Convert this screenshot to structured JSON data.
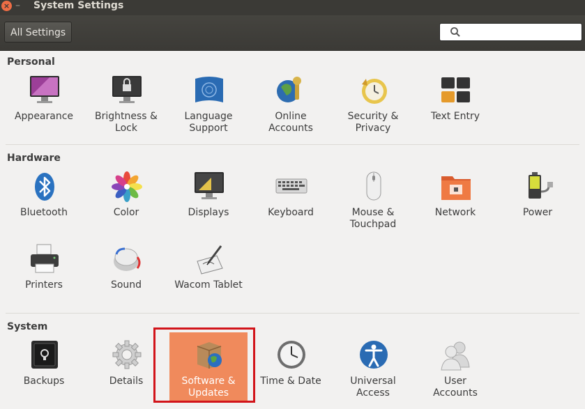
{
  "window": {
    "title": "System Settings"
  },
  "toolbar": {
    "all_settings": "All Settings",
    "search_placeholder": ""
  },
  "sections": {
    "personal": {
      "title": "Personal",
      "items": [
        {
          "label": "Appearance",
          "icon": "appearance-icon"
        },
        {
          "label": "Brightness &\nLock",
          "icon": "brightness-lock-icon"
        },
        {
          "label": "Language\nSupport",
          "icon": "language-support-icon"
        },
        {
          "label": "Online\nAccounts",
          "icon": "online-accounts-icon"
        },
        {
          "label": "Security &\nPrivacy",
          "icon": "security-privacy-icon"
        },
        {
          "label": "Text Entry",
          "icon": "text-entry-icon"
        }
      ]
    },
    "hardware": {
      "title": "Hardware",
      "items": [
        {
          "label": "Bluetooth",
          "icon": "bluetooth-icon"
        },
        {
          "label": "Color",
          "icon": "color-icon"
        },
        {
          "label": "Displays",
          "icon": "displays-icon"
        },
        {
          "label": "Keyboard",
          "icon": "keyboard-icon"
        },
        {
          "label": "Mouse &\nTouchpad",
          "icon": "mouse-icon"
        },
        {
          "label": "Network",
          "icon": "network-icon"
        },
        {
          "label": "Power",
          "icon": "power-icon"
        },
        {
          "label": "Printers",
          "icon": "printer-icon"
        },
        {
          "label": "Sound",
          "icon": "sound-icon"
        },
        {
          "label": "Wacom Tablet",
          "icon": "wacom-tablet-icon"
        }
      ]
    },
    "system": {
      "title": "System",
      "items": [
        {
          "label": "Backups",
          "icon": "backups-icon"
        },
        {
          "label": "Details",
          "icon": "details-gear-icon"
        },
        {
          "label": "Software &\nUpdates",
          "icon": "software-updates-icon",
          "selected": true
        },
        {
          "label": "Time & Date",
          "icon": "clock-icon"
        },
        {
          "label": "Universal\nAccess",
          "icon": "universal-access-icon"
        },
        {
          "label": "User\nAccounts",
          "icon": "user-accounts-icon"
        }
      ]
    }
  },
  "colors": {
    "selection": "#f08a5c",
    "highlight_box": "#d2141a",
    "titlebar": "#3b3a36"
  }
}
